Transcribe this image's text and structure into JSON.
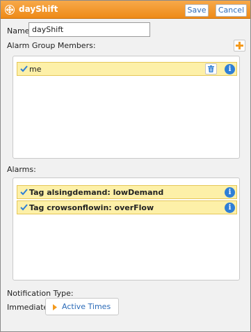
{
  "dialog": {
    "title": "dayShift",
    "save_label": "Save",
    "cancel_label": "Cancel"
  },
  "name_field": {
    "label": "Name:",
    "value": "dayShift"
  },
  "members": {
    "label": "Alarm Group Members:",
    "items": [
      {
        "label": "me"
      }
    ]
  },
  "alarms": {
    "label": "Alarms:",
    "items": [
      {
        "label": "Tag alsingdemand: lowDemand"
      },
      {
        "label": "Tag crowsonflowin: overFlow"
      }
    ]
  },
  "notification": {
    "label": "Notification Type:",
    "type_value": "Immediate",
    "active_times_label": "Active Times"
  },
  "colors": {
    "titlebar": "#ee8a17",
    "row_highlight": "#fdf0a8",
    "link_blue": "#2b6bb8",
    "info_blue": "#2f7fd6",
    "add_orange": "#f39a1e"
  },
  "icons": {
    "title": "move-handle-icon",
    "add": "plus-icon",
    "check": "checkmark-icon",
    "delete": "trash-icon",
    "info": "info-icon",
    "expand": "triangle-right-icon"
  }
}
